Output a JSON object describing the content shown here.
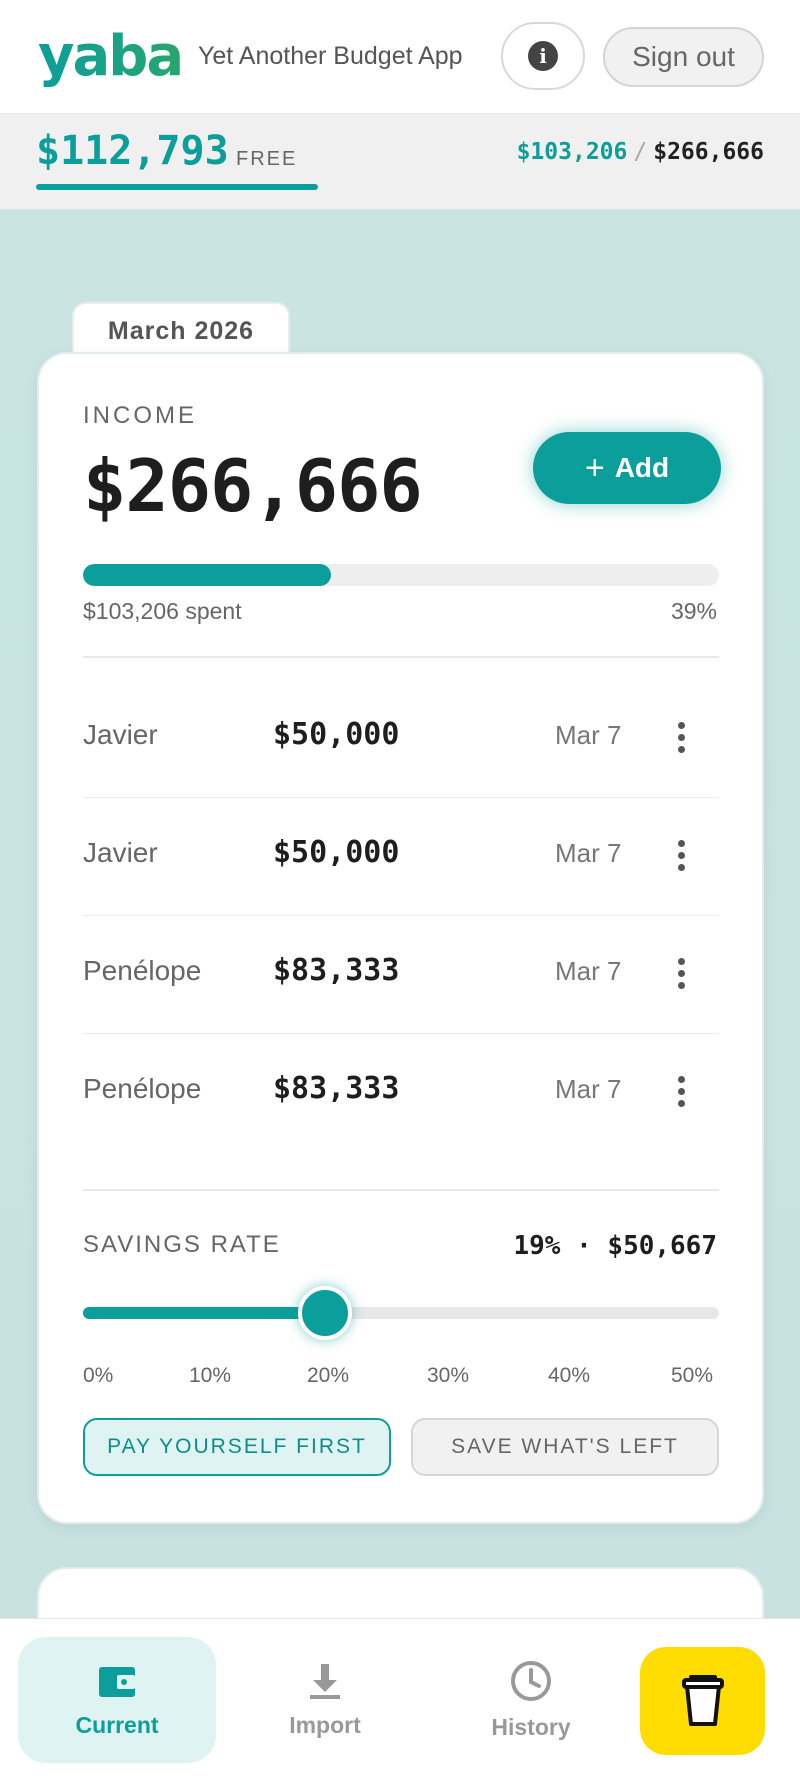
{
  "header": {
    "logo": "yaba",
    "tagline": "Yet Another Budget App",
    "info_icon_glyph": "i",
    "signout_label": "Sign out"
  },
  "summary": {
    "free_amount": "$112,793",
    "free_label": "FREE",
    "free_fraction": 0.42,
    "spent": "$103,206",
    "separator": "/",
    "total": "$266,666"
  },
  "month_tab": "March 2026",
  "income": {
    "label": "INCOME",
    "amount": "$266,666",
    "add_label": "Add",
    "progress_fraction": 0.39,
    "spent_text": "$103,206 spent",
    "percent_text": "39%",
    "entries": [
      {
        "name": "Javier",
        "amount": "$50,000",
        "date": "Mar 7"
      },
      {
        "name": "Javier",
        "amount": "$50,000",
        "date": "Mar 7"
      },
      {
        "name": "Penélope",
        "amount": "$83,333",
        "date": "Mar 7"
      },
      {
        "name": "Penélope",
        "amount": "$83,333",
        "date": "Mar 7"
      }
    ]
  },
  "savings": {
    "label": "SAVINGS RATE",
    "value_text": "19% · $50,667",
    "rate_percent": 19,
    "slider_max_percent": 50,
    "ticks": [
      "0%",
      "10%",
      "20%",
      "30%",
      "40%",
      "50%"
    ],
    "mode_active": "PAY YOURSELF FIRST",
    "mode_inactive": "SAVE WHAT'S LEFT"
  },
  "nav": {
    "items": [
      {
        "label": "Current",
        "icon": "wallet-icon",
        "active": true
      },
      {
        "label": "Import",
        "icon": "download-icon",
        "active": false
      },
      {
        "label": "History",
        "icon": "clock-icon",
        "active": false
      }
    ],
    "coffee_icon": "coffee-cup-icon"
  },
  "colors": {
    "accent": "#0c9e9a",
    "background": "#c9e4e2",
    "coffee": "#ffdd00"
  }
}
